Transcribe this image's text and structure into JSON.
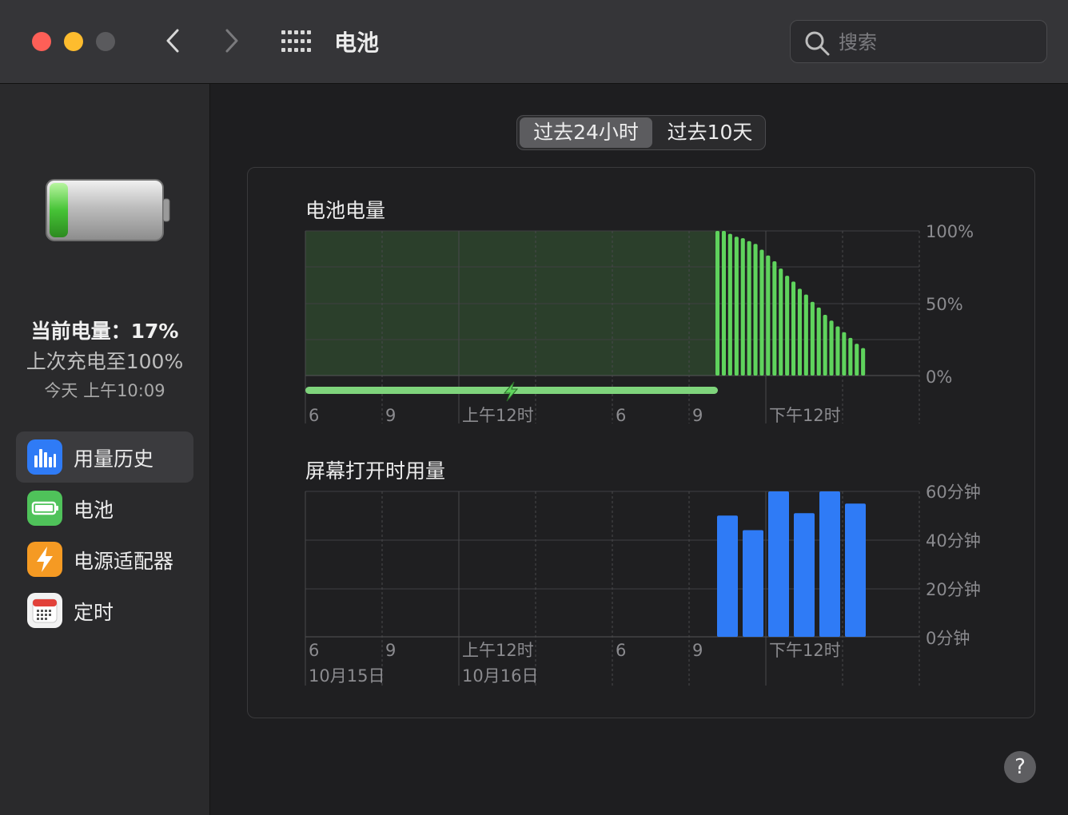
{
  "window": {
    "title": "电池",
    "search_placeholder": "搜索"
  },
  "battery_status": {
    "current": "当前电量：17%",
    "last_charged": "上次充电至100%",
    "time": "今天 上午10:09",
    "level_fraction": 0.17
  },
  "sidebar": {
    "items": [
      {
        "label": "用量历史",
        "icon": "usage-history-icon",
        "color": "#2f7bf6",
        "active": true
      },
      {
        "label": "电池",
        "icon": "battery-icon",
        "color": "#4fc25a",
        "active": false
      },
      {
        "label": "电源适配器",
        "icon": "power-adapter-icon",
        "color": "#f59a23",
        "active": false
      },
      {
        "label": "定时",
        "icon": "schedule-icon",
        "color": "#f2f2f2",
        "active": false
      }
    ]
  },
  "tabs": [
    {
      "label": "过去24小时",
      "selected": true
    },
    {
      "label": "过去10天",
      "selected": false
    }
  ],
  "chart_data": [
    {
      "type": "bar",
      "title": "电池电量",
      "yticks": [
        "100%",
        "50%",
        "0%"
      ],
      "ylim": [
        0,
        100
      ],
      "xticks": [
        "6",
        "9",
        "上午12时",
        "6",
        "9",
        "下午12时"
      ],
      "charging_segment": "6 → 10:09 (charging)",
      "values": [
        100,
        100,
        98,
        96,
        95,
        93,
        91,
        87,
        83,
        79,
        74,
        69,
        65,
        60,
        56,
        51,
        47,
        42,
        38,
        34,
        30,
        26,
        22,
        19
      ],
      "color": "#5fd35d"
    },
    {
      "type": "bar",
      "title": "屏幕打开时用量",
      "yticks": [
        "60分钟",
        "40分钟",
        "20分钟",
        "0分钟"
      ],
      "ylim": [
        0,
        60
      ],
      "xticks": [
        "6",
        "9",
        "上午12时",
        "6",
        "9",
        "下午12时"
      ],
      "dates": [
        "10月15日",
        "10月16日"
      ],
      "values": [
        50,
        44,
        60,
        51,
        60,
        55
      ],
      "color": "#2f7bf6"
    }
  ]
}
